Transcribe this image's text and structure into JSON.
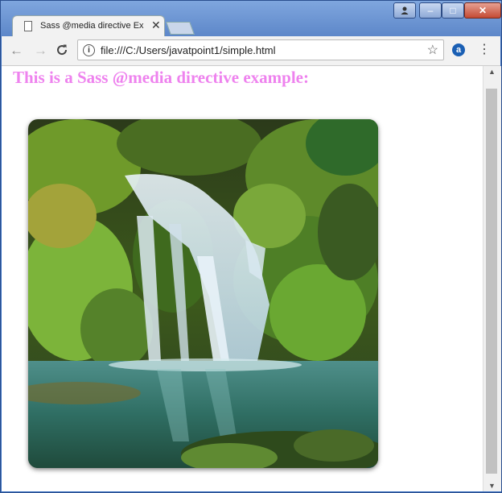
{
  "window": {
    "tab_title": "Sass @media directive Ex",
    "close_glyph": "✕",
    "minimize_glyph": "–",
    "maximize_glyph": "□",
    "user_glyph": "👤"
  },
  "toolbar": {
    "back_glyph": "←",
    "forward_glyph": "→",
    "reload_glyph": "C",
    "url": "file:///C:/Users/javatpoint1/simple.html",
    "info_glyph": "i",
    "star_glyph": "☆",
    "extension_glyph": "a",
    "menu_glyph": "⋮"
  },
  "page": {
    "heading": "This is a Sass @media directive example:",
    "heading_color": "#ee82ee",
    "image_subject": "waterfall"
  },
  "scrollbar": {
    "up_glyph": "▲",
    "down_glyph": "▼"
  }
}
